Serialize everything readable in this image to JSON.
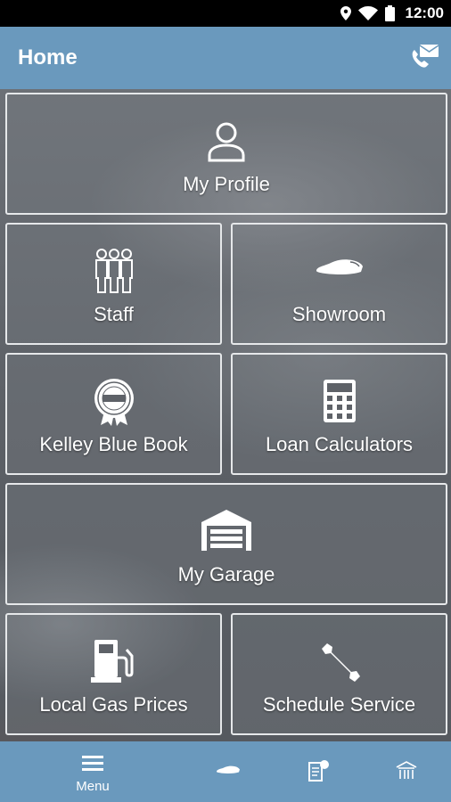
{
  "status_bar": {
    "time": "12:00"
  },
  "header": {
    "title": "Home",
    "contact_icon": "phone-mail-icon"
  },
  "tiles": {
    "my_profile": {
      "label": "My Profile",
      "icon": "person-icon"
    },
    "staff": {
      "label": "Staff",
      "icon": "group-icon"
    },
    "showroom": {
      "label": "Showroom",
      "icon": "car-icon"
    },
    "kelley_blue_book": {
      "label": "Kelley Blue Book",
      "icon": "kbb-badge-icon"
    },
    "loan_calculators": {
      "label": "Loan Calculators",
      "icon": "calculator-icon"
    },
    "my_garage": {
      "label": "My Garage",
      "icon": "garage-icon"
    },
    "local_gas_prices": {
      "label": "Local Gas Prices",
      "icon": "gas-pump-icon"
    },
    "schedule_service": {
      "label": "Schedule Service",
      "icon": "wrench-icon"
    }
  },
  "bottom_nav": {
    "menu_label": "Menu",
    "items": [
      "menu-icon",
      "car-icon",
      "document-badge-icon",
      "dealership-icon"
    ]
  }
}
